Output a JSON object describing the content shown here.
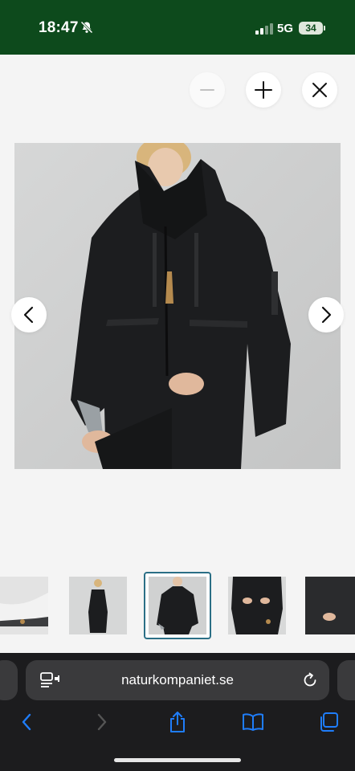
{
  "status_bar": {
    "time": "18:47",
    "network": "5G",
    "battery": "34",
    "icons": [
      "bell-slash-icon",
      "signal-icon"
    ]
  },
  "viewer": {
    "controls": [
      "zoom-out-icon",
      "zoom-in-icon",
      "close-icon"
    ],
    "navigation": [
      "chevron-left-icon",
      "chevron-right-icon"
    ],
    "thumbnail_count": 5,
    "active_thumbnail": 3
  },
  "browser": {
    "url": "naturkompaniet.se",
    "toolbar_icons": [
      "back-icon",
      "forward-icon",
      "share-icon",
      "bookmarks-icon",
      "tabs-icon"
    ],
    "accent_color": "#1f7dfa"
  }
}
